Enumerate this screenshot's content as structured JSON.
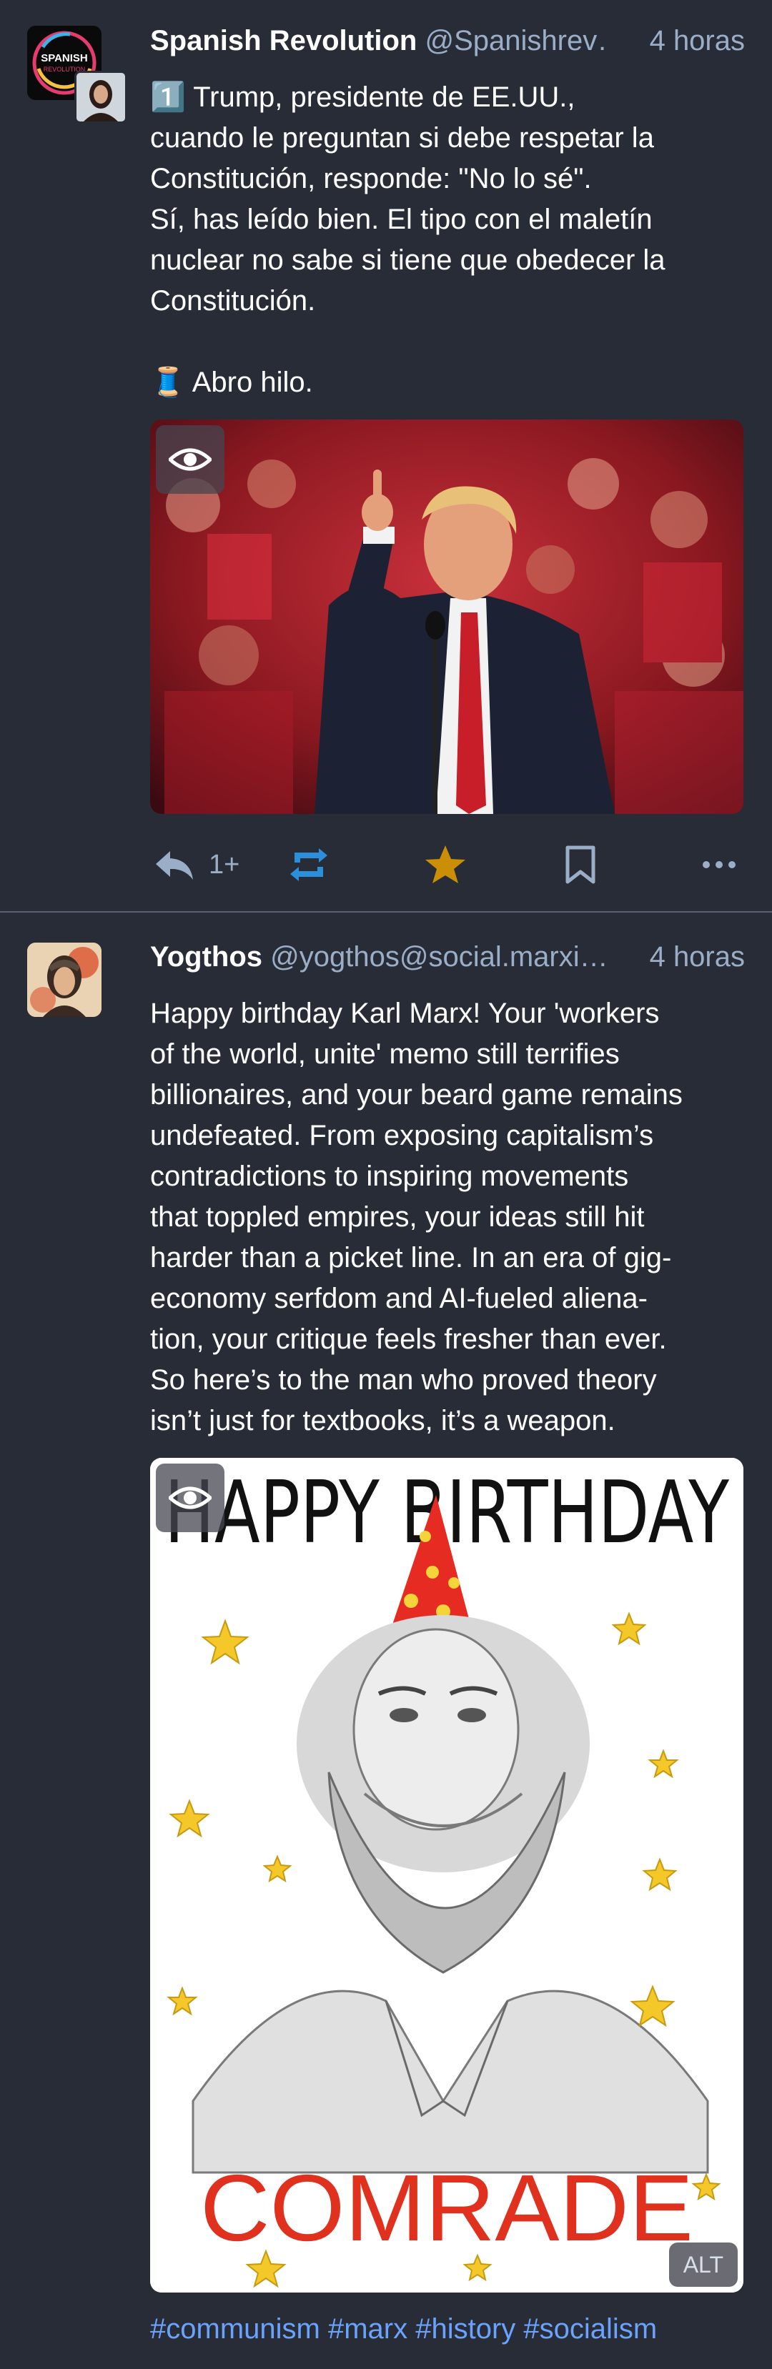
{
  "posts": [
    {
      "display_name": "Spanish Revolution",
      "acct": "@Spanishrev…",
      "time": "4 horas",
      "avatar_text_1": "SPANISH",
      "avatar_text_2": "REVOLUTION",
      "content_lines": [
        "1️⃣ Trump, presidente de EE.UU.,",
        "cuando le preguntan si debe respetar la",
        "Constitución, responde: \"No lo sé\".",
        "Sí, has leído bien. El tipo con el maletín",
        "nuclear no sabe si tiene que obedecer la",
        "Constitución.",
        "",
        "🧵 Abro hilo."
      ],
      "reply_count": "1+"
    },
    {
      "display_name": "Yogthos",
      "acct": "@yogthos@social.marxi…",
      "time": "4 horas",
      "content_lines": [
        "Happy birthday Karl Marx! Your 'workers",
        "of the world, unite' memo still terrifies",
        "billionaires, and your beard game remains",
        "undefeated. From exposing capitalism’s",
        "contradictions to inspiring movements",
        "that toppled empires, your ideas still hit",
        "harder than a picket line. In an era of gig-",
        "economy serfdom and AI-fueled aliena-",
        "tion, your critique feels fresher than ever.",
        "So here’s to the man who proved theory",
        "isn’t just for textbooks, it’s a weapon."
      ],
      "image_top_text": "HAPPY BIRTHDAY",
      "image_bottom_text": "COMRADE",
      "alt_label": "ALT",
      "hashtags": [
        "#communism",
        "#marx",
        "#history",
        "#socialism"
      ]
    }
  ],
  "colors": {
    "background": "#282c37",
    "secondary_text": "#9baec8",
    "boost_active": "#2b90d9",
    "favourite_active": "#ca8f04",
    "hashtag": "#6aa3ff"
  },
  "icons": [
    "reply-icon",
    "boost-icon",
    "star-icon",
    "bookmark-icon",
    "more-icon",
    "eye-icon"
  ]
}
